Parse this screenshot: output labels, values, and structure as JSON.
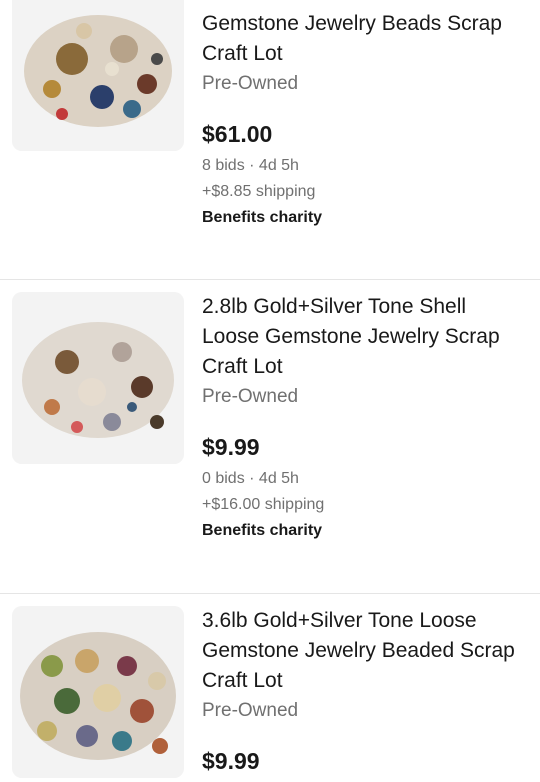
{
  "listings": [
    {
      "title_lines": [
        "Gemstone Jewelry Beads Scrap",
        "Craft Lot"
      ],
      "condition": "Pre-Owned",
      "price": "$61.00",
      "bids": "8 bids · 4d 5h",
      "shipping": "+$8.85 shipping",
      "charity": "Benefits charity",
      "thumb_icon": "jewelry-lot-photo"
    },
    {
      "title_lines": [
        "2.8lb Gold+Silver Tone Shell",
        "Loose Gemstone Jewelry Scrap",
        "Craft Lot"
      ],
      "condition": "Pre-Owned",
      "price": "$9.99",
      "bids": "0 bids · 4d 5h",
      "shipping": "+$16.00 shipping",
      "charity": "Benefits charity",
      "thumb_icon": "jewelry-lot-photo"
    },
    {
      "title_lines": [
        "3.6lb Gold+Silver Tone Loose",
        "Gemstone Jewelry Beaded Scrap",
        "Craft Lot"
      ],
      "condition": "Pre-Owned",
      "price": "$9.99",
      "thumb_icon": "gemstone-lot-photo"
    }
  ]
}
